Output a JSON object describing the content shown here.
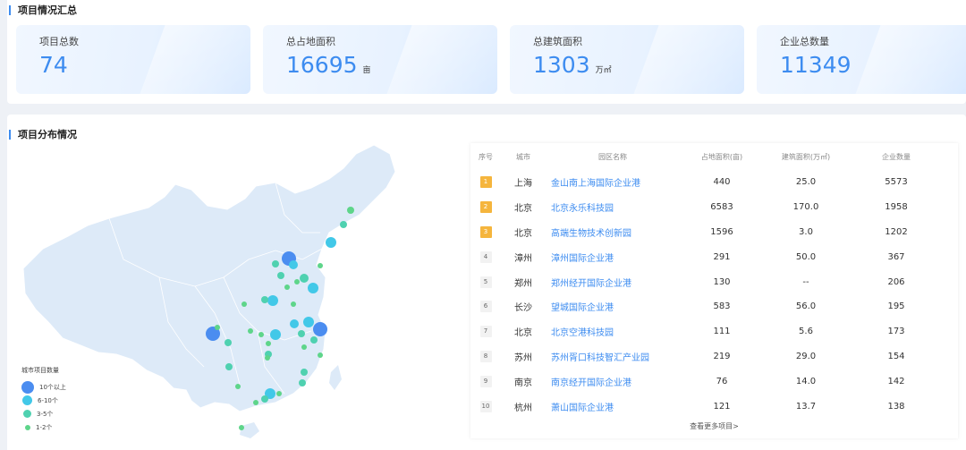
{
  "summary": {
    "title": "项目情况汇总",
    "cards": [
      {
        "label": "项目总数",
        "value": "74",
        "unit": ""
      },
      {
        "label": "总占地面积",
        "value": "16695",
        "unit": "亩"
      },
      {
        "label": "总建筑面积",
        "value": "1303",
        "unit": "万㎡"
      },
      {
        "label": "企业总数量",
        "value": "11349",
        "unit": ""
      }
    ]
  },
  "distribution": {
    "title": "项目分布情况",
    "legend": {
      "title": "城市项目数量",
      "items": [
        {
          "label": "10个以上",
          "color": "#4b8df0"
        },
        {
          "label": "6-10个",
          "color": "#42c8e8"
        },
        {
          "label": "3-5个",
          "color": "#4fd1b0"
        },
        {
          "label": "1-2个",
          "color": "#5ed58a"
        }
      ]
    }
  },
  "table": {
    "headers": [
      "序号",
      "城市",
      "园区名称",
      "占地面积(亩)",
      "建筑面积(万㎡)",
      "企业数量"
    ],
    "rows": [
      {
        "idx": "1",
        "city": "上海",
        "name": "金山南上海国际企业港",
        "area": "440",
        "build": "25.0",
        "count": "5573",
        "top": true
      },
      {
        "idx": "2",
        "city": "北京",
        "name": "北京永乐科技园",
        "area": "6583",
        "build": "170.0",
        "count": "1958",
        "top": true
      },
      {
        "idx": "3",
        "city": "北京",
        "name": "高端生物技术创新园",
        "area": "1596",
        "build": "3.0",
        "count": "1202",
        "top": true
      },
      {
        "idx": "4",
        "city": "漳州",
        "name": "漳州国际企业港",
        "area": "291",
        "build": "50.0",
        "count": "367",
        "top": false
      },
      {
        "idx": "5",
        "city": "郑州",
        "name": "郑州经开国际企业港",
        "area": "130",
        "build": "--",
        "count": "206",
        "top": false
      },
      {
        "idx": "6",
        "city": "长沙",
        "name": "望城国际企业港",
        "area": "583",
        "build": "56.0",
        "count": "195",
        "top": false
      },
      {
        "idx": "7",
        "city": "北京",
        "name": "北京空港科技园",
        "area": "111",
        "build": "5.6",
        "count": "173",
        "top": false
      },
      {
        "idx": "8",
        "city": "苏州",
        "name": "苏州胥口科技智汇产业园",
        "area": "219",
        "build": "29.0",
        "count": "154",
        "top": false
      },
      {
        "idx": "9",
        "city": "南京",
        "name": "南京经开国际企业港",
        "area": "76",
        "build": "14.0",
        "count": "142",
        "top": false
      },
      {
        "idx": "10",
        "city": "杭州",
        "name": "萧山国际企业港",
        "area": "121",
        "build": "13.7",
        "count": "138",
        "top": false
      }
    ],
    "more_label": "查看更多项目>"
  }
}
